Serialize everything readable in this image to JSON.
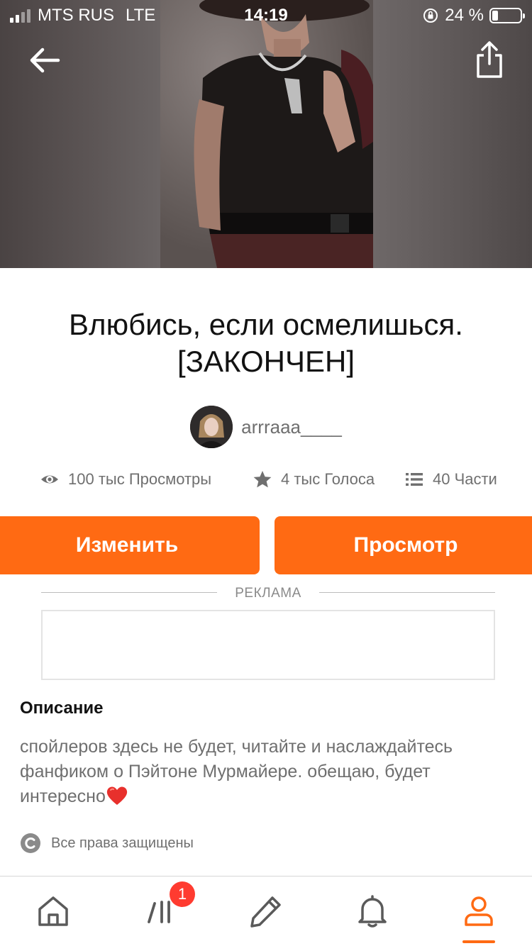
{
  "status_bar": {
    "carrier": "MTS RUS",
    "network": "LTE",
    "time": "14:19",
    "battery_percent_text": "24 %"
  },
  "icons": {
    "back": "arrow-left-icon",
    "share": "share-icon",
    "views": "eye-icon",
    "votes": "star-icon",
    "parts": "list-icon",
    "copyright": "copyright-icon",
    "heart": "heart-emoji"
  },
  "story": {
    "title_line1": "Влюбись, если осмелишься.",
    "title_line2": "[ЗАКОНЧЕН]",
    "author": "arrraaa____"
  },
  "stats": {
    "views": "100 тыс Просмотры",
    "votes": "4 тыс Голоса",
    "parts": "40 Части"
  },
  "actions": {
    "edit_label": "Изменить",
    "view_label": "Просмотр"
  },
  "ad": {
    "label": "РЕКЛАМА"
  },
  "description": {
    "heading": "Описание",
    "text": "спойлеров здесь не будет, читайте и наслаждайтесь фанфиком о Пэйтоне Мурмайере. обещаю, будет интересно"
  },
  "rights": {
    "text": "Все права защищены"
  },
  "tabbar": {
    "library_badge": "1",
    "active_tab": "profile"
  },
  "colors": {
    "accent": "#ff6a13",
    "badge": "#ff3b30",
    "text_primary": "#121212",
    "text_secondary": "#6f6f6f"
  }
}
